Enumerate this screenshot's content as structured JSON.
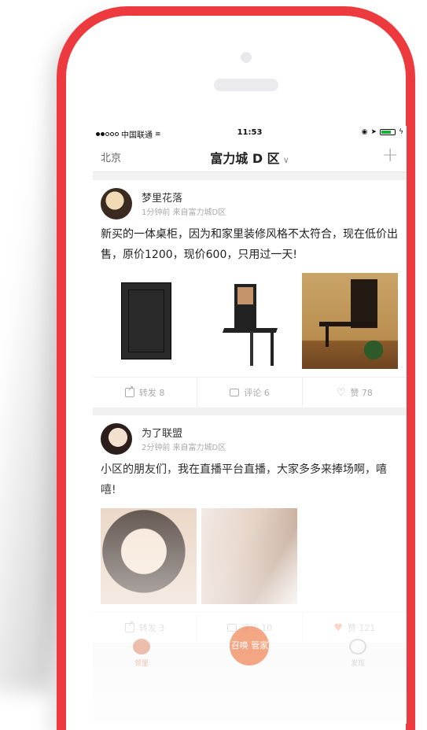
{
  "status_bar": {
    "carrier": "中国联通",
    "time": "11:53"
  },
  "nav": {
    "city": "北京",
    "title": "富力城 D 区",
    "add_label": "+"
  },
  "posts": [
    {
      "user": "梦里花落",
      "meta": "1分钟前  来自富力城D区",
      "text": "新买的一体桌柜，因为和家里装修风格不太符合，现在低价出售，原价1200，现价600，只用过一天!",
      "share": "转发 8",
      "comment": "评论 6",
      "like": "赞 78"
    },
    {
      "user": "为了联盟",
      "meta": "2分钟前  来自富力城D区",
      "text": "小区的朋友们，我在直播平台直播，大家多多来捧场啊，嘻嘻!",
      "share": "转发 3",
      "comment": "评论 10",
      "like": "赞 121"
    }
  ],
  "tab_bar": {
    "center_label": "召唤 管家",
    "left_label": "邻里",
    "right_label": "发现"
  },
  "colors": {
    "frame": "#ec3a3f",
    "accent": "#f08a5d"
  }
}
